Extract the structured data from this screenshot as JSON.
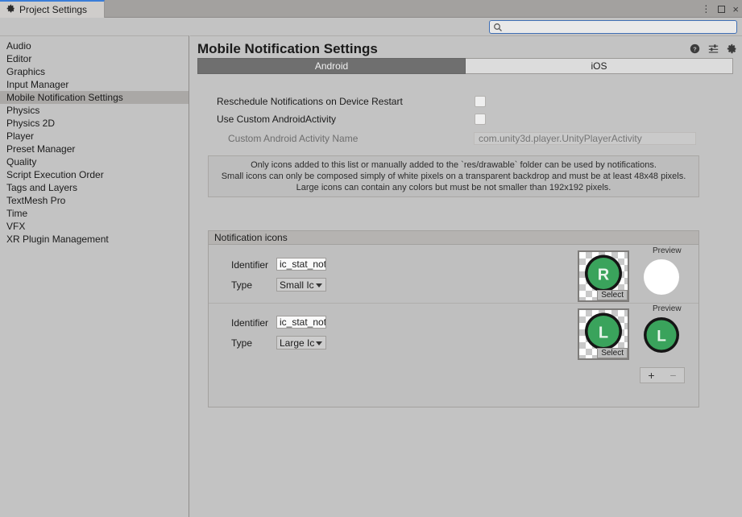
{
  "window": {
    "tab_title": "Project Settings",
    "tab_icon": "gear-icon",
    "controls": {
      "menu": "⋮",
      "maximize": "maximize-icon",
      "close": "×"
    }
  },
  "toolbar": {
    "search": {
      "value": "",
      "placeholder": "",
      "icon": "search-icon"
    }
  },
  "sidebar": {
    "items": [
      {
        "label": "Audio",
        "selected": false
      },
      {
        "label": "Editor",
        "selected": false
      },
      {
        "label": "Graphics",
        "selected": false
      },
      {
        "label": "Input Manager",
        "selected": false
      },
      {
        "label": "Mobile Notification Settings",
        "selected": true
      },
      {
        "label": "Physics",
        "selected": false
      },
      {
        "label": "Physics 2D",
        "selected": false
      },
      {
        "label": "Player",
        "selected": false
      },
      {
        "label": "Preset Manager",
        "selected": false
      },
      {
        "label": "Quality",
        "selected": false
      },
      {
        "label": "Script Execution Order",
        "selected": false
      },
      {
        "label": "Tags and Layers",
        "selected": false
      },
      {
        "label": "TextMesh Pro",
        "selected": false
      },
      {
        "label": "Time",
        "selected": false
      },
      {
        "label": "VFX",
        "selected": false
      },
      {
        "label": "XR Plugin Management",
        "selected": false
      }
    ]
  },
  "main": {
    "title": "Mobile Notification Settings",
    "header_icons": [
      "help-icon",
      "preset-icon",
      "gear-icon"
    ],
    "platform_tabs": [
      {
        "label": "Android",
        "active": true
      },
      {
        "label": "iOS",
        "active": false
      }
    ],
    "settings": [
      {
        "label": "Reschedule Notifications on Device Restart",
        "type": "checkbox",
        "checked": false
      },
      {
        "label": "Use Custom AndroidActivity",
        "type": "checkbox",
        "checked": false
      },
      {
        "label": "Custom Android Activity Name",
        "type": "text",
        "value": "com.unity3d.player.UnityPlayerActivity",
        "disabled": true
      }
    ],
    "help_box": {
      "lines": [
        "Only icons added to this list or manually added to the `res/drawable` folder can be used by notifications.",
        "Small icons can only be  composed simply of white pixels on a transparent backdrop and must be at least 48x48 pixels.",
        "Large icons can contain any colors but must be not smaller than 192x192 pixels."
      ]
    },
    "notification_icons": {
      "group_title": "Notification icons",
      "identifier_label": "Identifier",
      "type_label": "Type",
      "preview_label": "Preview",
      "select_label": "Select",
      "entries": [
        {
          "identifier": "ic_stat_not",
          "type": "Small Ic",
          "thumb_letter": "R",
          "thumb_color": "#3aa35c",
          "preview_kind": "white-circle",
          "preview_letter": ""
        },
        {
          "identifier": "ic_stat_not",
          "type": "Large Ic",
          "thumb_letter": "L",
          "thumb_color": "#3aa35c",
          "preview_kind": "green-circle",
          "preview_letter": "L"
        }
      ],
      "add_label": "+",
      "remove_label": "−"
    }
  },
  "colors": {
    "background": "#c3c3c3",
    "titlebar": "#a3a19f",
    "tab_accent": "#3b7dd8",
    "selected_row": "#aaa8a6",
    "active_platform_tab": "#6f6f6f",
    "icon_green": "#3aa35c"
  }
}
